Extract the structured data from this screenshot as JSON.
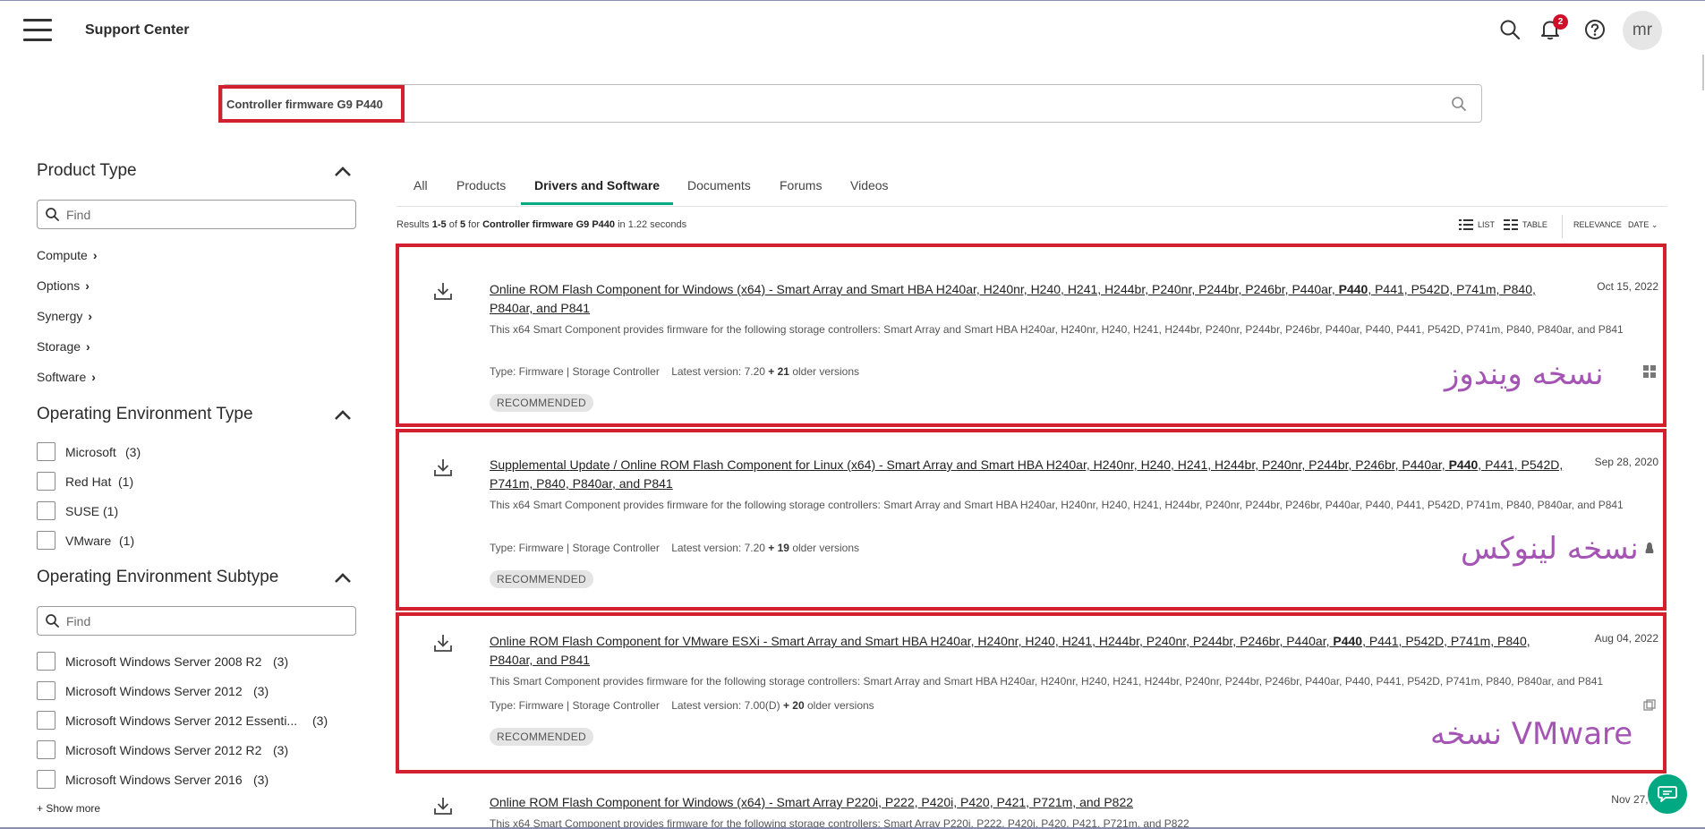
{
  "header": {
    "title": "Support Center",
    "notification_count": "2",
    "avatar_initials": "mr",
    "icons": [
      "menu-icon",
      "search-icon",
      "bell-icon",
      "help-icon"
    ]
  },
  "search": {
    "query": "Controller firmware G9 P440"
  },
  "sidebar": {
    "product_type": {
      "title": "Product Type",
      "find_placeholder": "Find",
      "items": [
        "Compute",
        "Options",
        "Synergy",
        "Storage",
        "Software"
      ]
    },
    "os_type": {
      "title": "Operating Environment Type",
      "items": [
        {
          "label": "Microsoft",
          "count": "(3)"
        },
        {
          "label": "Red Hat",
          "count": "(1)"
        },
        {
          "label": "SUSE",
          "count": "(1)"
        },
        {
          "label": "VMware",
          "count": "(1)"
        }
      ]
    },
    "os_subtype": {
      "title": "Operating Environment Subtype",
      "find_placeholder": "Find",
      "items": [
        {
          "label": "Microsoft Windows Server 2008 R2",
          "count": "(3)"
        },
        {
          "label": "Microsoft Windows Server 2012",
          "count": "(3)"
        },
        {
          "label": "Microsoft Windows Server 2012 Essenti...",
          "count": "(3)"
        },
        {
          "label": "Microsoft Windows Server 2012 R2",
          "count": "(3)"
        },
        {
          "label": "Microsoft Windows Server 2016",
          "count": "(3)"
        }
      ],
      "show_more": "+ Show more"
    }
  },
  "tabs": [
    "All",
    "Products",
    "Drivers and Software",
    "Documents",
    "Forums",
    "Videos"
  ],
  "active_tab": "Drivers and Software",
  "results_summary": {
    "prefix": "Results",
    "range": "1-5",
    "of": "of",
    "total": "5",
    "for": "for",
    "query": "Controller firmware G9 P440",
    "time": "in 1.22 seconds"
  },
  "view_controls": {
    "list": "LIST",
    "table": "TABLE",
    "relevance": "RELEVANCE",
    "date": "DATE"
  },
  "results": [
    {
      "title_pre": "Online ROM Flash Component for Windows (x64) - Smart Array and Smart HBA H240ar, H240nr, H240, H241, H244br, P240nr, P244br, P246br, P440ar, ",
      "title_bold": "P440",
      "title_post": ", P441, P542D, P741m, P840, P840ar, and P841",
      "date": "Oct 15, 2022",
      "description": "This x64 Smart Component provides firmware for the following storage controllers: Smart Array and Smart HBA H240ar, H240nr, H240, H241, H244br, P240nr, P244br, P246br, P440ar, P440, P441, P542D, P741m, P840, P840ar, and P841",
      "type": "Type: Firmware | Storage Controller",
      "latest": "Latest version: 7.20",
      "older": "+ 21",
      "older_label": "older versions",
      "badge": "RECOMMENDED",
      "os_icon": "windows-icon",
      "annotation": "نسخه ویندوز"
    },
    {
      "title_pre": "Supplemental Update / Online ROM Flash Component for Linux (x64) - Smart Array and Smart HBA H240ar, H240nr, H240, H241, H244br, P240nr, P244br, P246br, P440ar, ",
      "title_bold": "P440",
      "title_post": ", P441, P542D, P741m, P840, P840ar, and P841",
      "date": "Sep 28, 2020",
      "description": "This x64 Smart Component provides firmware for the following storage controllers: Smart Array and Smart HBA H240ar, H240nr, H240, H241, H244br, P240nr, P244br, P246br, P440ar, P440, P441, P542D, P741m, P840, P840ar, and P841",
      "type": "Type: Firmware | Storage Controller",
      "latest": "Latest version: 7.20",
      "older": "+ 19",
      "older_label": "older versions",
      "badge": "RECOMMENDED",
      "os_icon": "linux-icon",
      "annotation": "نسخه لینوکس"
    },
    {
      "title_pre": "Online ROM Flash Component for VMware ESXi - Smart Array and Smart HBA H240ar, H240nr, H240, H241, H244br, P240nr, P244br, P246br, P440ar, ",
      "title_bold": "P440",
      "title_post": ", P441, P542D, P741m, P840, P840ar, and P841",
      "date": "Aug 04, 2022",
      "description": "This Smart Component provides firmware for the following storage controllers: Smart Array and Smart HBA H240ar, H240nr, H240, H241, H244br, P240nr, P244br, P246br, P440ar, P440, P441, P542D, P741m, P840, P840ar, and P841",
      "type": "Type: Firmware | Storage Controller",
      "latest": "Latest version: 7.00(D)",
      "older": "+ 20",
      "older_label": "older versions",
      "badge": "RECOMMENDED",
      "os_icon": "vmware-icon",
      "annotation": "نسخه VMware"
    },
    {
      "title": "Online ROM Flash Component for Windows (x64) - Smart Array P220i, P222, P420i, P420, P421, P721m, and P822",
      "date": "Nov 27, 201",
      "description": "This x64 Smart Component provides firmware for the following storage controllers: Smart Array P220i, P222, P420i, P420, P421, P721m, and P822"
    }
  ],
  "colors": {
    "accent": "#01a982",
    "highlight_box": "#d3202e",
    "annotation_text": "#a455b4",
    "badge_bg": "#e4e4e4"
  }
}
